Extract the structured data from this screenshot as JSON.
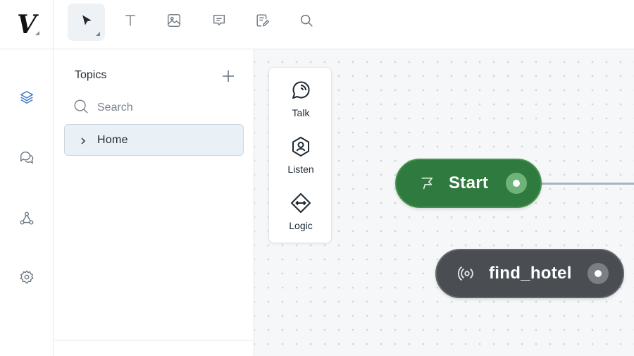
{
  "app": {
    "logo_text": "V"
  },
  "rail": {
    "items": [
      {
        "name": "layers-icon",
        "active": true
      },
      {
        "name": "chat-icon",
        "active": false
      },
      {
        "name": "integrations-icon",
        "active": false
      },
      {
        "name": "settings-icon",
        "active": false
      }
    ]
  },
  "toolbar": {
    "tools": [
      {
        "name": "select-tool",
        "icon": "pointer-icon",
        "active": true
      },
      {
        "name": "text-tool",
        "icon": "text-icon",
        "active": false
      },
      {
        "name": "image-tool",
        "icon": "image-icon",
        "active": false
      },
      {
        "name": "comment-tool",
        "icon": "comment-icon",
        "active": false
      },
      {
        "name": "notes-tool",
        "icon": "note-edit-icon",
        "active": false
      },
      {
        "name": "search-tool",
        "icon": "search-icon",
        "active": false
      }
    ]
  },
  "topics": {
    "title": "Topics",
    "search_placeholder": "Search",
    "items": [
      {
        "label": "Home"
      }
    ]
  },
  "palette": {
    "items": [
      {
        "label": "Talk",
        "icon": "talk-icon"
      },
      {
        "label": "Listen",
        "icon": "listen-icon"
      },
      {
        "label": "Logic",
        "icon": "logic-icon"
      }
    ]
  },
  "canvas": {
    "nodes": [
      {
        "title": "Start",
        "icon": "flag-icon",
        "color": "#2f7a3e"
      },
      {
        "title": "find_hotel",
        "icon": "intent-icon",
        "color": "#4a4e53"
      }
    ]
  },
  "colors": {
    "accent": "#3c78c8",
    "start_node": "#2f7a3e",
    "intent_node": "#4a4e53",
    "icon_gray": "#6b7580"
  }
}
